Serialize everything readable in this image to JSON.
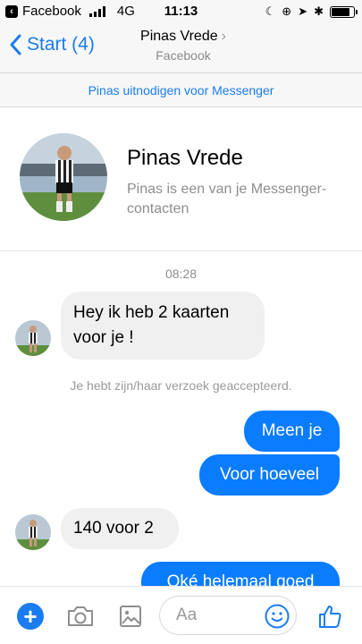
{
  "status_bar": {
    "app_back_label": "Facebook",
    "network": "4G",
    "time": "11:13"
  },
  "nav": {
    "back_label": "Start (4)",
    "title": "Pinas Vrede",
    "subtitle": "Facebook"
  },
  "invite_banner": "Pinas uitnodigen voor Messenger",
  "profile": {
    "name": "Pinas Vrede",
    "description": "Pinas is een van je Messenger-contacten"
  },
  "conversation": {
    "timestamp": "08:28",
    "messages": [
      {
        "from": "them",
        "text": "Hey ik heb 2 kaarten voor je !"
      },
      {
        "from": "system",
        "text": "Je hebt zijn/haar verzoek geaccepteerd."
      },
      {
        "from": "me",
        "text": "Meen je"
      },
      {
        "from": "me",
        "text": "Voor hoeveel"
      },
      {
        "from": "them",
        "text": "140 voor 2"
      },
      {
        "from": "me",
        "text": "Oké helemaal goed"
      }
    ]
  },
  "composer": {
    "placeholder": "Aa"
  },
  "icons": {
    "add": "plus-icon",
    "camera": "camera-icon",
    "gallery": "image-icon",
    "emoji": "emoji-icon",
    "like": "thumbs-up-icon"
  },
  "colors": {
    "accent": "#1a7cf0",
    "outgoing_bubble": "#0a7cff",
    "incoming_bubble": "#f1f0f0"
  }
}
